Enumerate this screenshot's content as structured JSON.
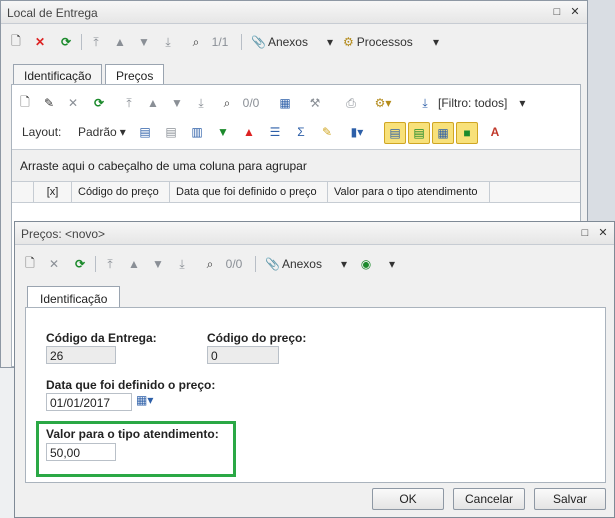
{
  "back_window": {
    "title": "Local de Entrega",
    "toolbar": {
      "record_position": "1/1",
      "attachments_label": "Anexos",
      "processes_label": "Processos"
    },
    "tabs": [
      {
        "label": "Identificação"
      },
      {
        "label": "Preços"
      }
    ],
    "grid_toolbar": {
      "record_position": "0/0",
      "filter_label": "[Filtro: todos]"
    },
    "layout_toolbar": {
      "layout_label": "Layout:",
      "layout_value": "Padrão"
    },
    "group_hint": "Arraste aqui o cabeçalho de uma coluna para agrupar",
    "columns": [
      "[x]",
      "Código do preço",
      "Data que foi definido o preço",
      "Valor para o tipo atendimento"
    ]
  },
  "dialog": {
    "title": "Preços: <novo>",
    "toolbar": {
      "record_position": "0/0",
      "attachments_label": "Anexos"
    },
    "tabs": [
      {
        "label": "Identificação"
      }
    ],
    "fields": {
      "codigo_entrega": {
        "label": "Código da Entrega:",
        "value": "26"
      },
      "codigo_preco": {
        "label": "Código do preço:",
        "value": "0"
      },
      "data_definido": {
        "label": "Data que foi definido o preço:",
        "value": "01/01/2017"
      },
      "valor_tipo": {
        "label": "Valor para o tipo atendimento:",
        "value": "50,00"
      }
    },
    "buttons": {
      "ok": "OK",
      "cancel": "Cancelar",
      "save": "Salvar"
    }
  },
  "colors": {
    "highlight_box": "#2aa845",
    "accent_green": "#1c8a2c",
    "delete_red": "#d22222"
  },
  "icons": [
    "new-icon",
    "delete-icon",
    "refresh-icon",
    "first-icon",
    "prev-icon",
    "next-icon",
    "last-icon",
    "binoculars-icon",
    "paperclip-icon",
    "process-icon",
    "calendar-icon",
    "chart-icon",
    "globe-icon"
  ]
}
